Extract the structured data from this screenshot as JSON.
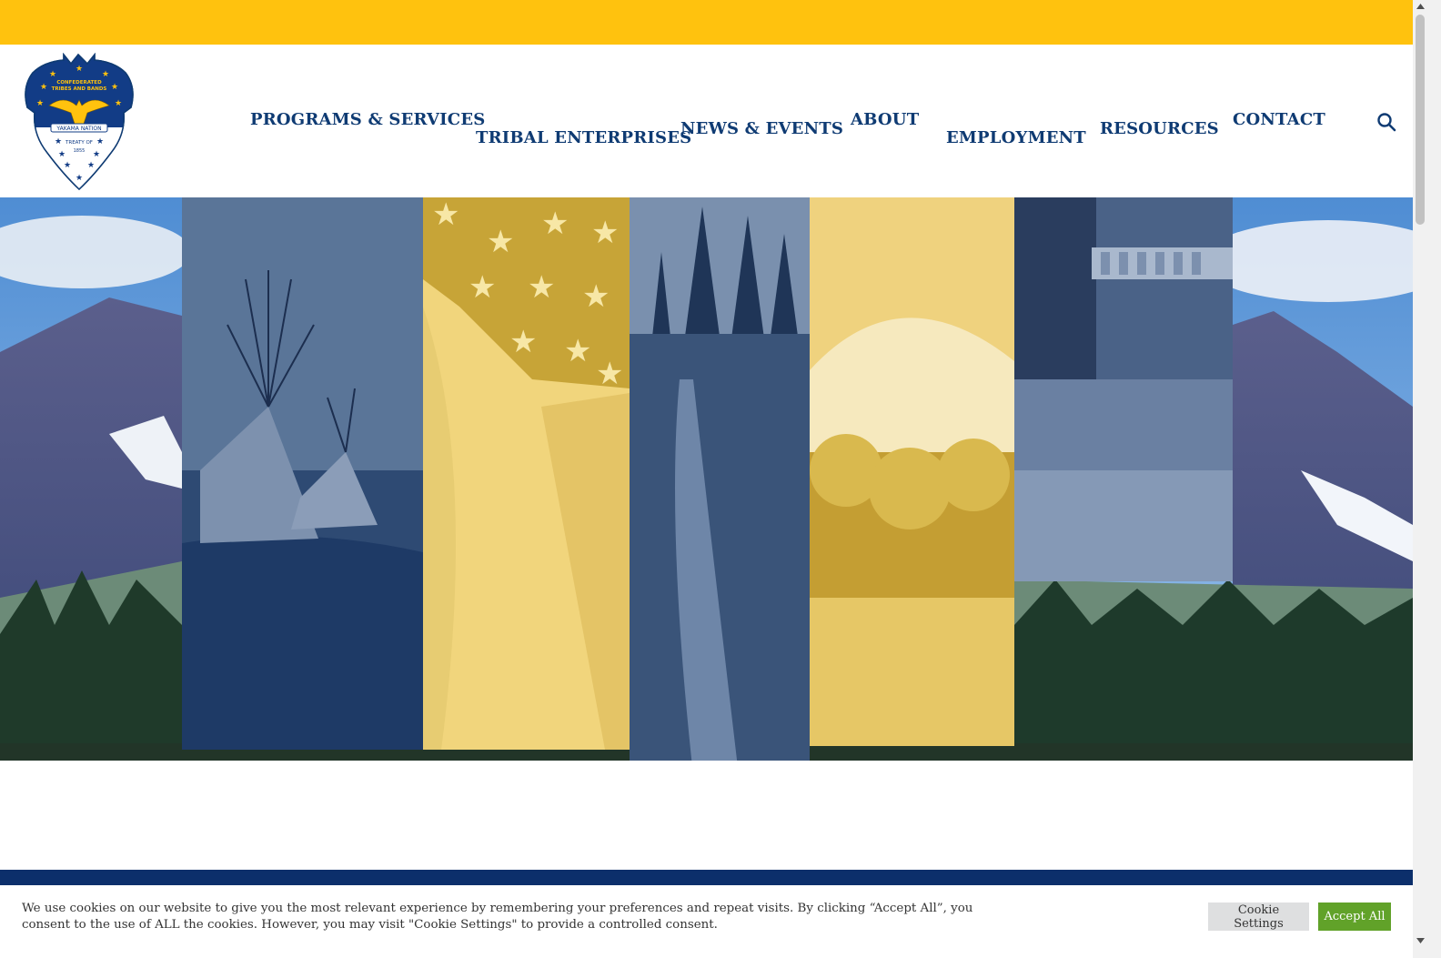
{
  "header": {
    "logo_name": "Confederated Tribes and Bands Yakama Nation seal",
    "logo_text": [
      "CONFEDERATED",
      "TRIBES AND BANDS",
      "YAKAMA NATION",
      "TREATY OF",
      "1855"
    ],
    "nav": [
      {
        "label": "PROGRAMS & SERVICES"
      },
      {
        "label": "TRIBAL ENTERPRISES"
      },
      {
        "label": "NEWS & EVENTS"
      },
      {
        "label": "ABOUT"
      },
      {
        "label": "EMPLOYMENT"
      },
      {
        "label": "RESOURCES"
      },
      {
        "label": "CONTACT"
      }
    ],
    "search_icon": "search-icon"
  },
  "hero": {
    "background": "mountain landscape with forest",
    "panels": [
      {
        "name": "tipis",
        "tint": "navy"
      },
      {
        "name": "american-flag",
        "tint": "gold"
      },
      {
        "name": "forest-trail",
        "tint": "navy"
      },
      {
        "name": "mount-adams",
        "tint": "gold"
      },
      {
        "name": "dam-and-grassland",
        "tint": "navy"
      }
    ]
  },
  "cookie": {
    "text": "We use cookies on our website to give you the most relevant experience by remembering your preferences and repeat visits. By clicking “Accept All”, you consent to the use of ALL the cookies. However, you may visit \"Cookie Settings\" to provide a controlled consent.",
    "settings_label": "Cookie Settings",
    "accept_label": "Accept All"
  },
  "colors": {
    "accent_gold": "#FFC20E",
    "nav_blue": "#0F3B73",
    "navy_band": "#0C2F6B",
    "accept_green": "#61A229"
  }
}
